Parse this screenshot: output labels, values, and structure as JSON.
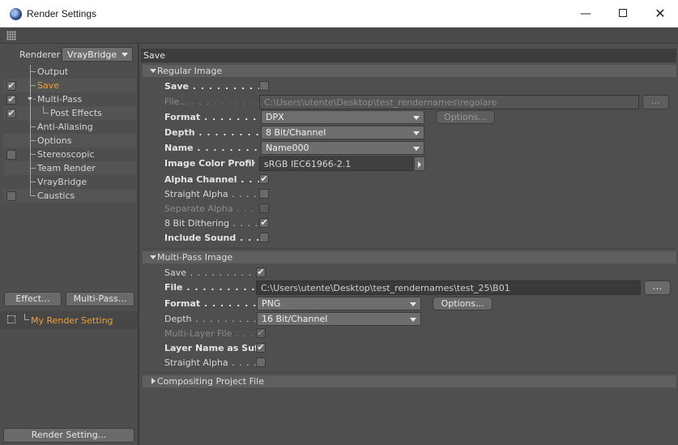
{
  "window": {
    "title": "Render Settings",
    "minimize_glyph": "—",
    "close_glyph": "✕"
  },
  "left": {
    "renderer_label": "Renderer",
    "renderer_value": "VrayBridge",
    "tree": [
      {
        "label": "Output",
        "checkbox": false,
        "checked": false,
        "active": false
      },
      {
        "label": "Save",
        "checkbox": true,
        "checked": true,
        "active": true
      },
      {
        "label": "Multi-Pass",
        "checkbox": true,
        "checked": true,
        "active": false,
        "expanded": true
      },
      {
        "label": "Post Effects",
        "checkbox": true,
        "checked": true,
        "active": false,
        "child": true
      },
      {
        "label": "Anti-Aliasing",
        "checkbox": false,
        "checked": false,
        "active": false
      },
      {
        "label": "Options",
        "checkbox": false,
        "checked": false,
        "active": false
      },
      {
        "label": "Stereoscopic",
        "checkbox": true,
        "checked": false,
        "active": false
      },
      {
        "label": "Team Render",
        "checkbox": false,
        "checked": false,
        "active": false
      },
      {
        "label": "VrayBridge",
        "checkbox": false,
        "checked": false,
        "active": false
      },
      {
        "label": "Caustics",
        "checkbox": true,
        "checked": false,
        "active": false
      }
    ],
    "effect_button": "Effect...",
    "multipass_button": "Multi-Pass...",
    "render_setting_name": "My Render Setting",
    "render_setting_button": "Render Setting..."
  },
  "right": {
    "header": "Save",
    "regular": {
      "title": "Regular Image",
      "save_label": "Save",
      "save_dots": " . . . . . . . . . . . . . . . . .",
      "save_checked": false,
      "file_label": "File...",
      "file_dots": " . . . . . . . . . . . . . .",
      "file_path": "C:\\Users\\utente\\Desktop\\test_rendernames\\regolare",
      "file_button": "...",
      "format_label": "Format",
      "format_dots": " . . . . . . . . . . . . .",
      "format_value": "DPX",
      "options_button": "Options...",
      "depth_label": "Depth",
      "depth_dots": " . . . . . . . . . . . . . .",
      "depth_value": "8 Bit/Channel",
      "name_label": "Name",
      "name_dots": " . . . . . . . . . . . . . .",
      "name_value": "Name000",
      "profile_label": "Image Color Profile",
      "profile_value": "sRGB IEC61966-2.1",
      "alpha_label": "Alpha Channel",
      "alpha_dots": " . . . . . .",
      "alpha_checked": true,
      "straight_label": "Straight Alpha",
      "straight_dots": " . . . . . .",
      "straight_checked": false,
      "separate_label": "Separate Alpha",
      "separate_dots": " . . . . .",
      "separate_checked": false,
      "dither_label": "8 Bit Dithering",
      "dither_dots": " . . . . . .",
      "dither_checked": true,
      "sound_label": "Include Sound",
      "sound_dots": " . . . . . .",
      "sound_checked": false
    },
    "multipass": {
      "title": "Multi-Pass Image",
      "save_label": "Save",
      "save_dots": " . . . . . . . . . . . . . . . .",
      "save_checked": true,
      "file_label": "File",
      "file_dots": " . . . . . . . . . . . . . . . . .",
      "file_path": "C:\\Users\\utente\\Desktop\\test_rendernames\\test_25\\B01",
      "file_button": "...",
      "format_label": "Format",
      "format_dots": " . . . . . . . . . . . . .",
      "format_value": "PNG",
      "options_button": "Options...",
      "depth_label": "Depth",
      "depth_dots": " . . . . . . . . . . . . . .",
      "depth_value": "16 Bit/Channel",
      "multilayer_label": "Multi-Layer File",
      "multilayer_dots": " . . . . .",
      "multilayer_checked": true,
      "suffix_label": "Layer Name as Suffix",
      "suffix_checked": true,
      "straight_label": "Straight Alpha",
      "straight_dots": " . . . . . .",
      "straight_checked": false
    },
    "compositing_title": "Compositing Project File"
  },
  "check_glyph": "✔"
}
